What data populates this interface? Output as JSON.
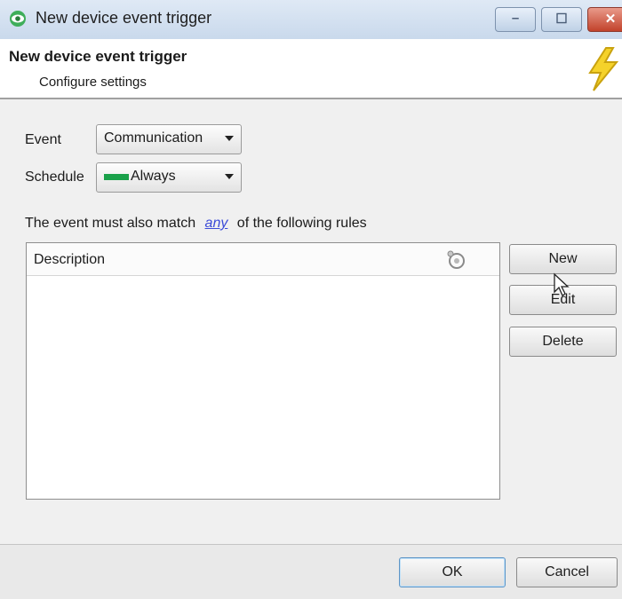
{
  "window": {
    "title": "New device event trigger",
    "controls": {
      "minimize": "–",
      "maximize": "☐",
      "close": "✕"
    }
  },
  "header": {
    "title": "New device event trigger",
    "subtitle": "Configure settings",
    "icon": "lightning-bolt-icon"
  },
  "form": {
    "event_label": "Event",
    "event_value": "Communication",
    "schedule_label": "Schedule",
    "schedule_value": "Always",
    "schedule_color": "#1aa14a"
  },
  "rules": {
    "prefix": "The event must also match",
    "match_mode": "any",
    "suffix": "of the following rules",
    "columns": [
      "Description"
    ],
    "rows": []
  },
  "side_buttons": {
    "new": "New",
    "edit": "Edit",
    "delete": "Delete"
  },
  "footer": {
    "ok": "OK",
    "cancel": "Cancel"
  },
  "colors": {
    "accent": "#3b4bd8",
    "titlebar": "#c9d9ec",
    "close": "#c2422b"
  }
}
